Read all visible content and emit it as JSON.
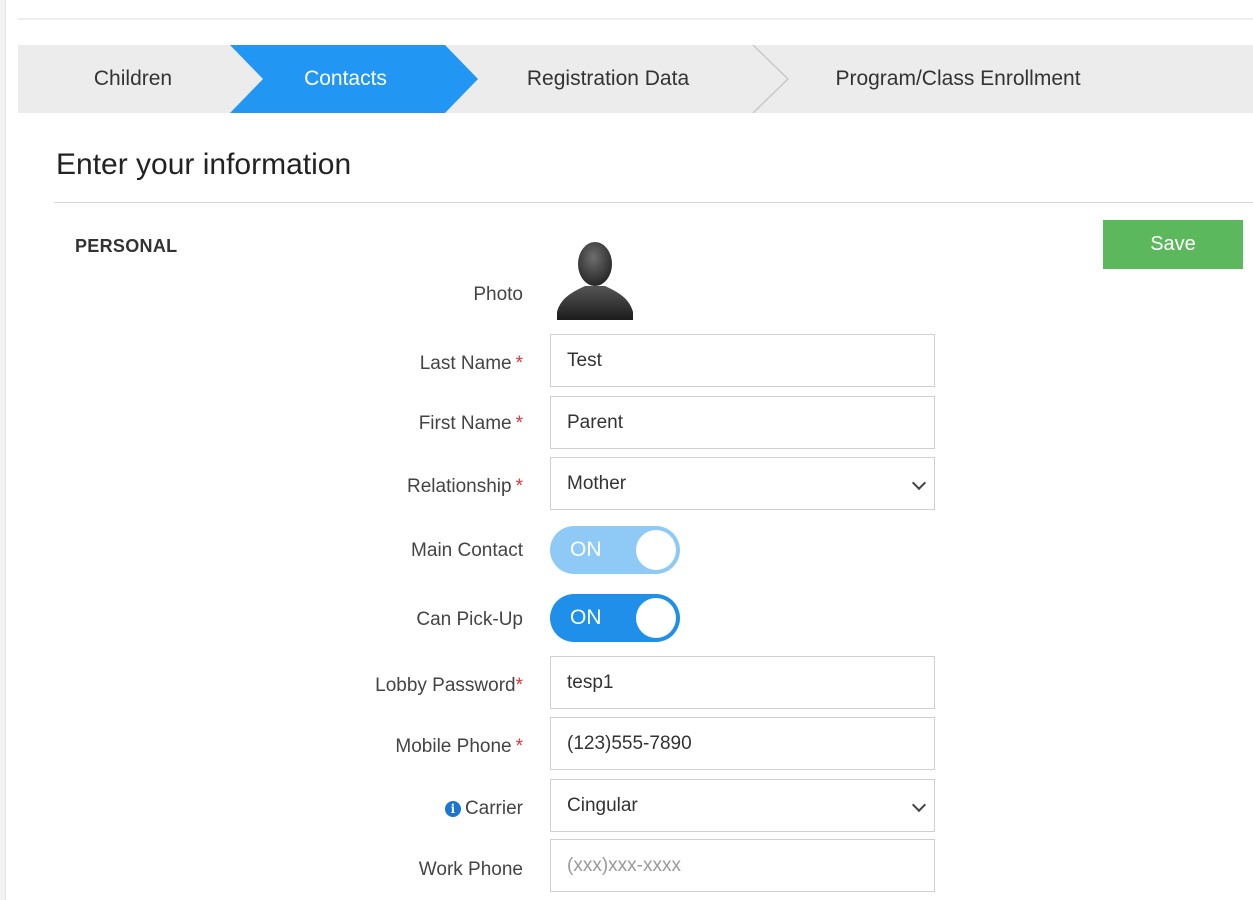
{
  "wizard": {
    "steps": [
      {
        "label": "Children",
        "active": false
      },
      {
        "label": "Contacts",
        "active": true
      },
      {
        "label": "Registration Data",
        "active": false
      },
      {
        "label": "Program/Class Enrollment",
        "active": false
      }
    ],
    "active_color": "#2196f3"
  },
  "page": {
    "title": "Enter your information",
    "section": "PERSONAL",
    "save_label": "Save"
  },
  "form": {
    "photo_label": "Photo",
    "last_name": {
      "label": "Last Name",
      "required_mark": "*",
      "value": "Test"
    },
    "first_name": {
      "label": "First Name",
      "required_mark": "*",
      "value": "Parent"
    },
    "relationship": {
      "label": "Relationship",
      "required_mark": "*",
      "value": "Mother"
    },
    "main_contact": {
      "label": "Main Contact",
      "value": "ON"
    },
    "can_pickup": {
      "label": "Can Pick-Up",
      "value": "ON"
    },
    "lobby_password": {
      "label": "Lobby Password",
      "required_mark": "*",
      "value": "tesp1"
    },
    "mobile_phone": {
      "label": "Mobile Phone",
      "required_mark": "*",
      "value": "(123)555-7890"
    },
    "carrier": {
      "label": "Carrier",
      "icon": "info-icon",
      "value": "Cingular"
    },
    "work_phone": {
      "label": "Work Phone",
      "placeholder": "(xxx)xxx-xxxx"
    }
  },
  "colors": {
    "save_button": "#5cb85c",
    "toggle_main_contact": "#8fcaf7",
    "toggle_can_pickup": "#1f8fea",
    "required": "#e0353b"
  }
}
